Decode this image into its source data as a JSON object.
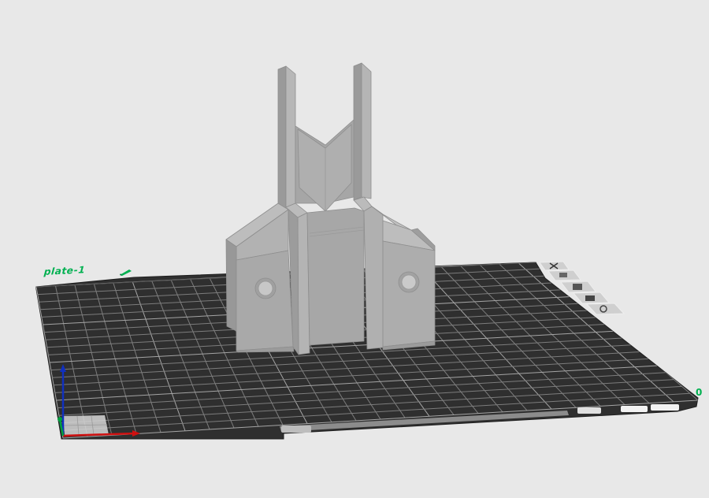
{
  "viewport": {
    "plate_name": "plate-1",
    "axis_origin_label": "0",
    "bed_side_text": "",
    "icons": {
      "plate_edit": "pencil-edit-icon",
      "tools": [
        "close-icon",
        "arrange-icon",
        "orient-icon",
        "lock-icon",
        "settings-icon"
      ]
    },
    "colors": {
      "background": "#e8e8e8",
      "bed": "#2f2f2f",
      "grid": "#8a8a8a",
      "model": "#a9a9a9",
      "plate_label": "#00b050",
      "axis_x": "#d01010",
      "axis_y": "#00a040",
      "axis_z": "#1030c0"
    }
  }
}
